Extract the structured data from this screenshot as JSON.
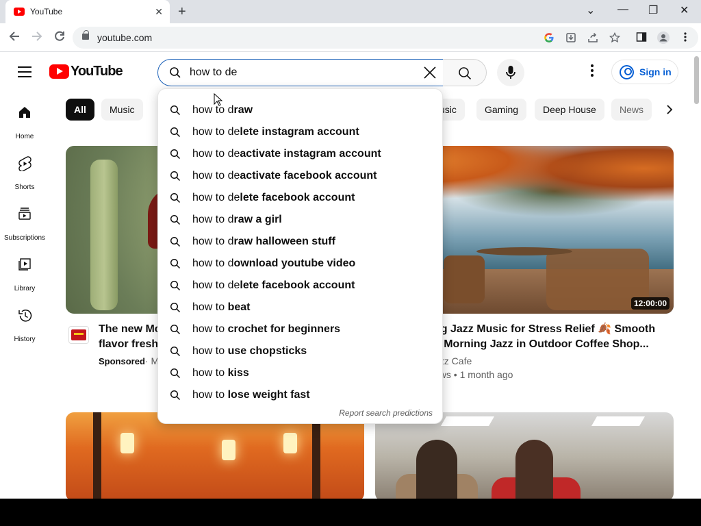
{
  "browser": {
    "tab_title": "YouTube",
    "tab_close": "✕",
    "new_tab": "+",
    "window_controls": [
      "⌄",
      "—",
      "❐",
      "✕"
    ],
    "url": "youtube.com"
  },
  "youtube": {
    "logo_text": "YouTube",
    "search": {
      "value": "how to de",
      "placeholder": "Search"
    },
    "sign_in_label": "Sign in",
    "guide": [
      {
        "label": "Home",
        "icon": "home-icon"
      },
      {
        "label": "Shorts",
        "icon": "shorts-icon"
      },
      {
        "label": "Subscriptions",
        "icon": "subscriptions-icon"
      },
      {
        "label": "Library",
        "icon": "library-icon"
      },
      {
        "label": "History",
        "icon": "history-icon"
      }
    ],
    "chips": [
      "All",
      "Music",
      "usic",
      "Gaming",
      "Deep House",
      "News"
    ],
    "suggestions": [
      {
        "typed": "how to d",
        "completion": "raw"
      },
      {
        "typed": "how to de",
        "completion": "lete instagram account"
      },
      {
        "typed": "how to de",
        "completion": "activate instagram account"
      },
      {
        "typed": "how to de",
        "completion": "activate facebook account"
      },
      {
        "typed": "how to de",
        "completion": "lete facebook account"
      },
      {
        "typed": "how to d",
        "completion": "raw a girl"
      },
      {
        "typed": "how to d",
        "completion": "raw halloween stuff"
      },
      {
        "typed": "how to d",
        "completion": "ownload youtube video"
      },
      {
        "typed": "how to de",
        "completion": "lete facebook account"
      },
      {
        "typed": "how to ",
        "completion": "beat"
      },
      {
        "typed": "how to ",
        "completion": "crochet for beginners"
      },
      {
        "typed": "how to ",
        "completion": "use chopsticks"
      },
      {
        "typed": "how to ",
        "completion": "kiss"
      },
      {
        "typed": "how to ",
        "completion": "lose weight fast"
      }
    ],
    "report_predictions": "Report search predictions",
    "videos": [
      {
        "title_line1": "The new Mc",
        "title_line2": "flavor fresh,",
        "meta_sponsored": "Sponsored",
        "meta_rest": "· M"
      },
      {
        "title_line1": "ng Jazz Music for Stress Relief 🍂 Smooth",
        "title_line2": "n Morning Jazz in Outdoor Coffee Shop...",
        "channel": "azz Cafe",
        "views_age": "ews • 1 month ago",
        "duration": "12:00:00"
      }
    ]
  },
  "colors": {
    "youtube_red": "#ff0000",
    "signin_blue": "#065fd4",
    "search_focus_border": "#1c62b9"
  }
}
